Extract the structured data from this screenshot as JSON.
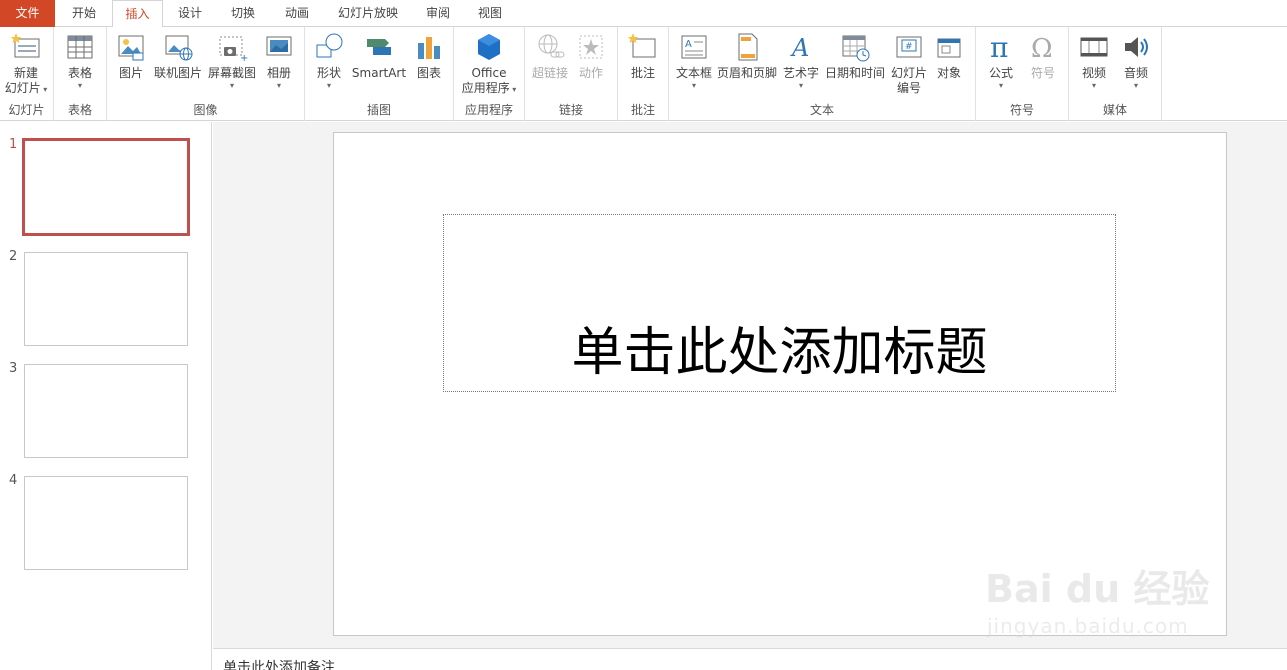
{
  "tabs": [
    "文件",
    "开始",
    "插入",
    "设计",
    "切换",
    "动画",
    "幻灯片放映",
    "审阅",
    "视图"
  ],
  "ribbon": {
    "groups": {
      "slides": "幻灯片",
      "tables": "表格",
      "images": "图像",
      "illustrations": "插图",
      "apps": "应用程序",
      "links": "链接",
      "comments": "批注",
      "text": "文本",
      "symbols": "符号",
      "media": "媒体"
    },
    "buttons": {
      "new_slide_1": "新建",
      "new_slide_2": "幻灯片",
      "table": "表格",
      "pictures": "图片",
      "online_pictures": "联机图片",
      "screenshot": "屏幕截图",
      "album": "相册",
      "shapes": "形状",
      "smartart": "SmartArt",
      "chart": "图表",
      "office_1": "Office",
      "office_2": "应用程序",
      "hyperlink": "超链接",
      "action": "动作",
      "comment": "批注",
      "textbox": "文本框",
      "header_footer": "页眉和页脚",
      "wordart": "艺术字",
      "datetime": "日期和时间",
      "slide_number_1": "幻灯片",
      "slide_number_2": "编号",
      "object": "对象",
      "equation": "公式",
      "symbol": "符号",
      "video": "视频",
      "audio": "音频"
    }
  },
  "thumbnails": [
    "1",
    "2",
    "3",
    "4"
  ],
  "slide": {
    "title_placeholder": "单击此处添加标题"
  },
  "notes": {
    "placeholder": "单击此处添加备注"
  },
  "watermark": {
    "brand": "Bai du 经验",
    "url": "jingyan.baidu.com"
  },
  "colors": {
    "accent": "#d24726",
    "selection": "#c0504d"
  }
}
